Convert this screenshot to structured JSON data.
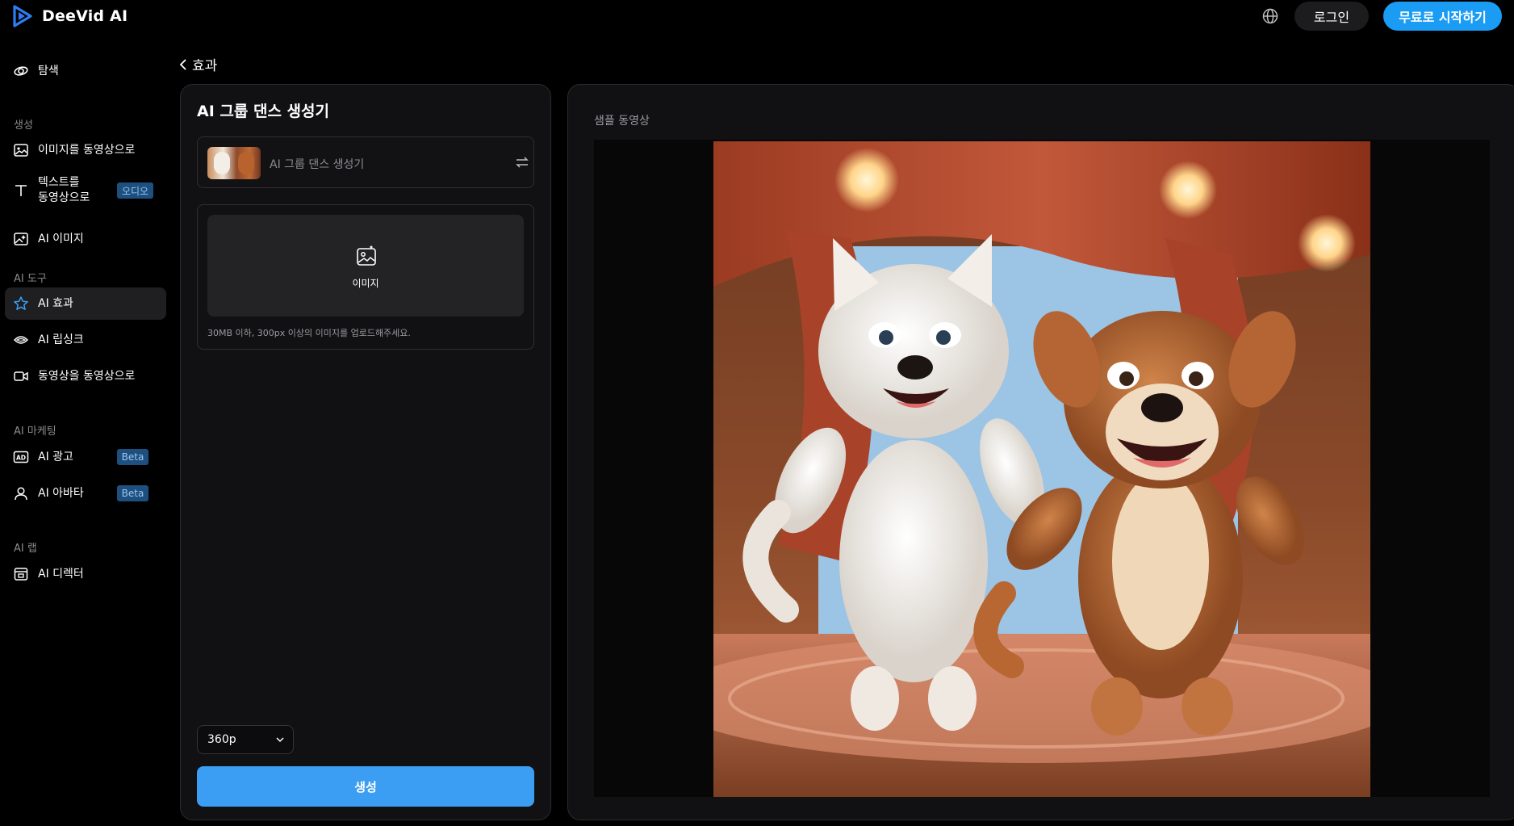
{
  "header": {
    "brand": "DeeVid AI",
    "login_label": "로그인",
    "start_label": "무료로 시작하기",
    "language_icon": "globe-icon"
  },
  "sidebar": {
    "explore": {
      "label": "탐색",
      "icon": "explore-icon"
    },
    "sections": [
      {
        "title": "생성"
      },
      {
        "title": "AI 도구"
      },
      {
        "title": "AI 마케팅"
      },
      {
        "title": "AI 랩"
      }
    ],
    "items": [
      {
        "label": "이미지를 동영상으로",
        "icon": "image-icon"
      },
      {
        "label": "텍스트를\n동영상으로",
        "icon": "text-icon",
        "badge": "오디오"
      },
      {
        "label": "AI 이미지",
        "icon": "ai-image-icon"
      },
      {
        "label": "AI 효과",
        "icon": "star-icon",
        "active": true
      },
      {
        "label": "AI 립싱크",
        "icon": "lipsync-icon"
      },
      {
        "label": "동영상을 동영상으로",
        "icon": "video-icon"
      },
      {
        "label": "AI 광고",
        "icon": "ad-icon",
        "badge": "Beta"
      },
      {
        "label": "AI 아바타",
        "icon": "avatar-icon",
        "badge": "Beta"
      },
      {
        "label": "AI 디렉터",
        "icon": "director-icon"
      }
    ]
  },
  "breadcrumb": {
    "label": "효과"
  },
  "panel": {
    "title": "AI 그룹 댄스 생성기",
    "effect_name": "AI 그룹 댄스 생성기",
    "upload_label": "이미지",
    "upload_hint": "30MB 이하, 300px 이상의 이미지를 업로드해주세요.",
    "resolution": "360p",
    "generate_label": "생성"
  },
  "preview": {
    "title": "샘플 동영상"
  },
  "colors": {
    "accent": "#1a9cf5",
    "generate": "#3b9ef2",
    "badge_bg": "#1d4f7f"
  }
}
